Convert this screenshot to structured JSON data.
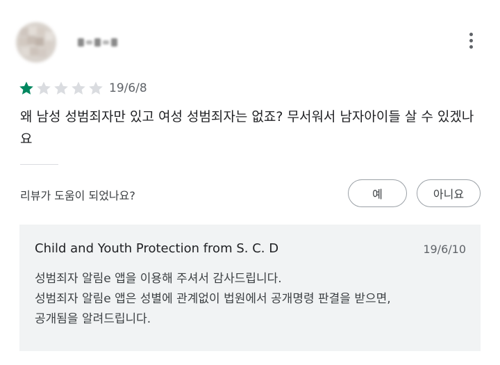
{
  "review": {
    "rating": 1,
    "max_rating": 5,
    "date": "19/6/8",
    "text": "왜 남성 성범죄자만 있고 여성 성범죄자는 없죠? 무서워서 남자아이들 살 수 있겠나요",
    "star_filled_color": "#01875f",
    "star_empty_color": "#dadce0"
  },
  "feedback": {
    "question": "리뷰가 도움이 되었나요?",
    "yes_label": "예",
    "no_label": "아니요"
  },
  "reply": {
    "developer": "Child and Youth Protection from S. C. D",
    "date": "19/6/10",
    "lines": [
      "성범죄자 알림e 앱을 이용해 주셔서 감사드립니다.",
      "성범죄자 알림e 앱은 성별에 관계없이 법원에서 공개명령 판결을 받으면,",
      "공개됨을 알려드립니다."
    ]
  },
  "icons": {
    "more": "more-vert-icon",
    "star": "star-icon"
  }
}
